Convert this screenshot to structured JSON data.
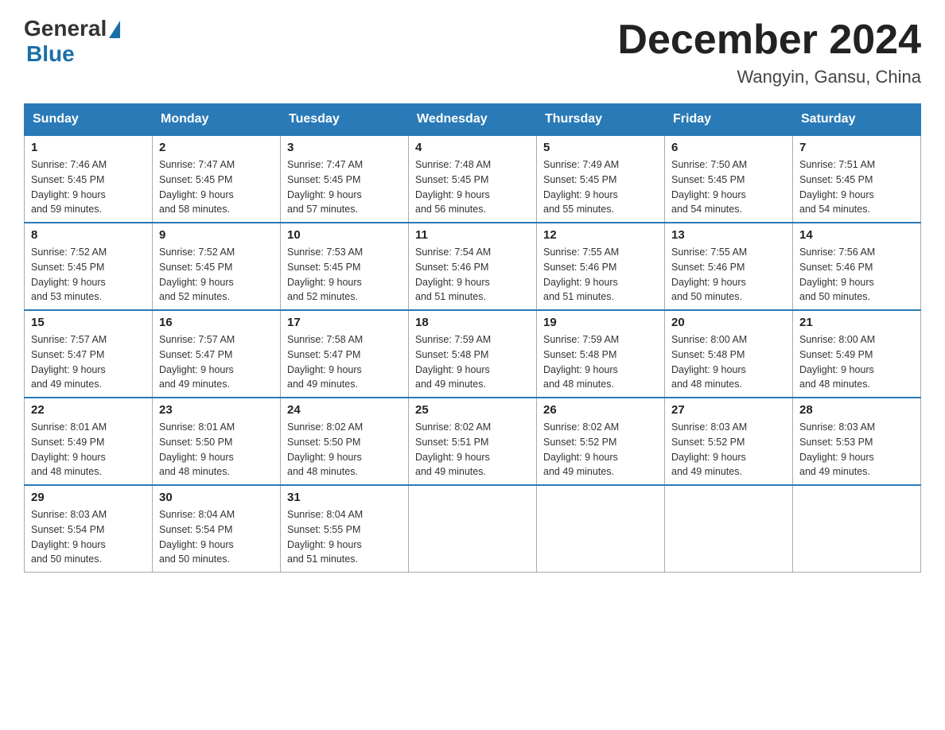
{
  "header": {
    "logo_general": "General",
    "logo_blue": "Blue",
    "month_title": "December 2024",
    "location": "Wangyin, Gansu, China"
  },
  "days_of_week": [
    "Sunday",
    "Monday",
    "Tuesday",
    "Wednesday",
    "Thursday",
    "Friday",
    "Saturday"
  ],
  "weeks": [
    [
      {
        "day": "1",
        "sunrise": "7:46 AM",
        "sunset": "5:45 PM",
        "daylight": "9 hours and 59 minutes."
      },
      {
        "day": "2",
        "sunrise": "7:47 AM",
        "sunset": "5:45 PM",
        "daylight": "9 hours and 58 minutes."
      },
      {
        "day": "3",
        "sunrise": "7:47 AM",
        "sunset": "5:45 PM",
        "daylight": "9 hours and 57 minutes."
      },
      {
        "day": "4",
        "sunrise": "7:48 AM",
        "sunset": "5:45 PM",
        "daylight": "9 hours and 56 minutes."
      },
      {
        "day": "5",
        "sunrise": "7:49 AM",
        "sunset": "5:45 PM",
        "daylight": "9 hours and 55 minutes."
      },
      {
        "day": "6",
        "sunrise": "7:50 AM",
        "sunset": "5:45 PM",
        "daylight": "9 hours and 54 minutes."
      },
      {
        "day": "7",
        "sunrise": "7:51 AM",
        "sunset": "5:45 PM",
        "daylight": "9 hours and 54 minutes."
      }
    ],
    [
      {
        "day": "8",
        "sunrise": "7:52 AM",
        "sunset": "5:45 PM",
        "daylight": "9 hours and 53 minutes."
      },
      {
        "day": "9",
        "sunrise": "7:52 AM",
        "sunset": "5:45 PM",
        "daylight": "9 hours and 52 minutes."
      },
      {
        "day": "10",
        "sunrise": "7:53 AM",
        "sunset": "5:45 PM",
        "daylight": "9 hours and 52 minutes."
      },
      {
        "day": "11",
        "sunrise": "7:54 AM",
        "sunset": "5:46 PM",
        "daylight": "9 hours and 51 minutes."
      },
      {
        "day": "12",
        "sunrise": "7:55 AM",
        "sunset": "5:46 PM",
        "daylight": "9 hours and 51 minutes."
      },
      {
        "day": "13",
        "sunrise": "7:55 AM",
        "sunset": "5:46 PM",
        "daylight": "9 hours and 50 minutes."
      },
      {
        "day": "14",
        "sunrise": "7:56 AM",
        "sunset": "5:46 PM",
        "daylight": "9 hours and 50 minutes."
      }
    ],
    [
      {
        "day": "15",
        "sunrise": "7:57 AM",
        "sunset": "5:47 PM",
        "daylight": "9 hours and 49 minutes."
      },
      {
        "day": "16",
        "sunrise": "7:57 AM",
        "sunset": "5:47 PM",
        "daylight": "9 hours and 49 minutes."
      },
      {
        "day": "17",
        "sunrise": "7:58 AM",
        "sunset": "5:47 PM",
        "daylight": "9 hours and 49 minutes."
      },
      {
        "day": "18",
        "sunrise": "7:59 AM",
        "sunset": "5:48 PM",
        "daylight": "9 hours and 49 minutes."
      },
      {
        "day": "19",
        "sunrise": "7:59 AM",
        "sunset": "5:48 PM",
        "daylight": "9 hours and 48 minutes."
      },
      {
        "day": "20",
        "sunrise": "8:00 AM",
        "sunset": "5:48 PM",
        "daylight": "9 hours and 48 minutes."
      },
      {
        "day": "21",
        "sunrise": "8:00 AM",
        "sunset": "5:49 PM",
        "daylight": "9 hours and 48 minutes."
      }
    ],
    [
      {
        "day": "22",
        "sunrise": "8:01 AM",
        "sunset": "5:49 PM",
        "daylight": "9 hours and 48 minutes."
      },
      {
        "day": "23",
        "sunrise": "8:01 AM",
        "sunset": "5:50 PM",
        "daylight": "9 hours and 48 minutes."
      },
      {
        "day": "24",
        "sunrise": "8:02 AM",
        "sunset": "5:50 PM",
        "daylight": "9 hours and 48 minutes."
      },
      {
        "day": "25",
        "sunrise": "8:02 AM",
        "sunset": "5:51 PM",
        "daylight": "9 hours and 49 minutes."
      },
      {
        "day": "26",
        "sunrise": "8:02 AM",
        "sunset": "5:52 PM",
        "daylight": "9 hours and 49 minutes."
      },
      {
        "day": "27",
        "sunrise": "8:03 AM",
        "sunset": "5:52 PM",
        "daylight": "9 hours and 49 minutes."
      },
      {
        "day": "28",
        "sunrise": "8:03 AM",
        "sunset": "5:53 PM",
        "daylight": "9 hours and 49 minutes."
      }
    ],
    [
      {
        "day": "29",
        "sunrise": "8:03 AM",
        "sunset": "5:54 PM",
        "daylight": "9 hours and 50 minutes."
      },
      {
        "day": "30",
        "sunrise": "8:04 AM",
        "sunset": "5:54 PM",
        "daylight": "9 hours and 50 minutes."
      },
      {
        "day": "31",
        "sunrise": "8:04 AM",
        "sunset": "5:55 PM",
        "daylight": "9 hours and 51 minutes."
      },
      null,
      null,
      null,
      null
    ]
  ],
  "labels": {
    "sunrise": "Sunrise:",
    "sunset": "Sunset:",
    "daylight": "Daylight:"
  }
}
